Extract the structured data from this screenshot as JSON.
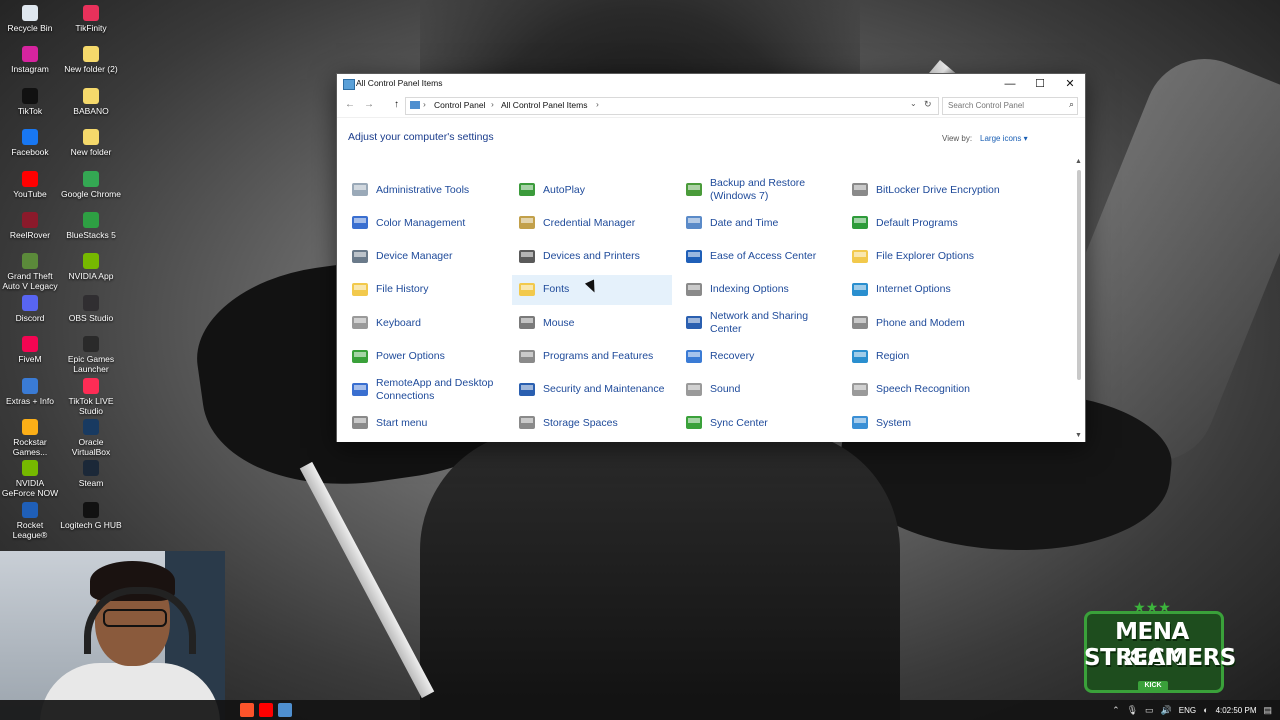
{
  "desktop_icons": [
    {
      "label": "Recycle Bin",
      "color": "#dfe7ef"
    },
    {
      "label": "TikFinity",
      "color": "#e8315b"
    },
    {
      "label": "Instagram",
      "color": "#d6249f"
    },
    {
      "label": "New folder (2)",
      "color": "#f5d96b"
    },
    {
      "label": "TikTok",
      "color": "#111111"
    },
    {
      "label": "BABANO",
      "color": "#f5d96b"
    },
    {
      "label": "Facebook",
      "color": "#1877f2"
    },
    {
      "label": "New folder",
      "color": "#f5d96b"
    },
    {
      "label": "YouTube",
      "color": "#ff0000"
    },
    {
      "label": "Google Chrome",
      "color": "#34a853"
    },
    {
      "label": "ReelRover",
      "color": "#8b1a2b"
    },
    {
      "label": "BlueStacks 5",
      "color": "#2ea043"
    },
    {
      "label": "Grand Theft Auto V Legacy",
      "color": "#5b8a3a"
    },
    {
      "label": "NVIDIA App",
      "color": "#76b900"
    },
    {
      "label": "Discord",
      "color": "#5865f2"
    },
    {
      "label": "OBS Studio",
      "color": "#302e31"
    },
    {
      "label": "FiveM",
      "color": "#f40552"
    },
    {
      "label": "Epic Games Launcher",
      "color": "#2a2a2a"
    },
    {
      "label": "Extras + Info",
      "color": "#3a7bd5"
    },
    {
      "label": "TikTok LIVE Studio",
      "color": "#fe2c55"
    },
    {
      "label": "Rockstar Games...",
      "color": "#fcaf17"
    },
    {
      "label": "Oracle VirtualBox",
      "color": "#183a61"
    },
    {
      "label": "NVIDIA GeForce NOW",
      "color": "#76b900"
    },
    {
      "label": "Steam",
      "color": "#1b2838"
    },
    {
      "label": "Rocket League®",
      "color": "#1f5fb8"
    },
    {
      "label": "Logitech G HUB",
      "color": "#111111"
    }
  ],
  "window": {
    "title": "All Control Panel Items",
    "controls": {
      "minimize": "—",
      "maximize": "☐",
      "close": "✕"
    },
    "nav": {
      "back": "←",
      "forward": "→",
      "up": "↑"
    },
    "breadcrumb": [
      "Control Panel",
      "All Control Panel Items"
    ],
    "search_placeholder": "Search Control Panel",
    "heading": "Adjust your computer's settings",
    "view_by_label": "View by:",
    "view_by_value": "Large icons ▾",
    "items": [
      {
        "label": "Administrative Tools",
        "icon": "admin-tools-icon",
        "color": "#9aa9b8"
      },
      {
        "label": "AutoPlay",
        "icon": "autoplay-icon",
        "color": "#3b9b3b"
      },
      {
        "label": "Backup and Restore (Windows 7)",
        "icon": "backup-icon",
        "color": "#4a9b3a"
      },
      {
        "label": "BitLocker Drive Encryption",
        "icon": "bitlocker-icon",
        "color": "#8a8a8a"
      },
      {
        "label": "Color Management",
        "icon": "color-management-icon",
        "color": "#3a6fd0"
      },
      {
        "label": "Credential Manager",
        "icon": "credential-manager-icon",
        "color": "#c2a04a"
      },
      {
        "label": "Date and Time",
        "icon": "date-time-icon",
        "color": "#5a8ac8"
      },
      {
        "label": "Default Programs",
        "icon": "default-programs-icon",
        "color": "#2e9b3a"
      },
      {
        "label": "Device Manager",
        "icon": "device-manager-icon",
        "color": "#6a7a8a"
      },
      {
        "label": "Devices and Printers",
        "icon": "printer-icon",
        "color": "#5a5a5a"
      },
      {
        "label": "Ease of Access Center",
        "icon": "ease-access-icon",
        "color": "#1f5fb8"
      },
      {
        "label": "File Explorer Options",
        "icon": "folder-options-icon",
        "color": "#f2c94c"
      },
      {
        "label": "File History",
        "icon": "file-history-icon",
        "color": "#f2c94c"
      },
      {
        "label": "Fonts",
        "icon": "fonts-icon",
        "color": "#f2c94c"
      },
      {
        "label": "Indexing Options",
        "icon": "indexing-icon",
        "color": "#8a8a8a"
      },
      {
        "label": "Internet Options",
        "icon": "internet-options-icon",
        "color": "#2a8fcf"
      },
      {
        "label": "Keyboard",
        "icon": "keyboard-icon",
        "color": "#9a9a9a"
      },
      {
        "label": "Mouse",
        "icon": "mouse-icon",
        "color": "#7a7a7a"
      },
      {
        "label": "Network and Sharing Center",
        "icon": "network-icon",
        "color": "#2a5fb0"
      },
      {
        "label": "Phone and Modem",
        "icon": "phone-modem-icon",
        "color": "#8a8a8a"
      },
      {
        "label": "Power Options",
        "icon": "power-options-icon",
        "color": "#3aa13a"
      },
      {
        "label": "Programs and Features",
        "icon": "programs-features-icon",
        "color": "#8a8a8a"
      },
      {
        "label": "Recovery",
        "icon": "recovery-icon",
        "color": "#3a7bd5"
      },
      {
        "label": "Region",
        "icon": "region-icon",
        "color": "#2a8fcf"
      },
      {
        "label": "RemoteApp and Desktop Connections",
        "icon": "remoteapp-icon",
        "color": "#3a6fd0"
      },
      {
        "label": "Security and Maintenance",
        "icon": "security-flag-icon",
        "color": "#2a5fb0"
      },
      {
        "label": "Sound",
        "icon": "sound-icon",
        "color": "#9a9a9a"
      },
      {
        "label": "Speech Recognition",
        "icon": "microphone-icon",
        "color": "#9a9a9a"
      },
      {
        "label": "Start menu",
        "icon": "start-menu-icon",
        "color": "#8a8a8a"
      },
      {
        "label": "Storage Spaces",
        "icon": "storage-spaces-icon",
        "color": "#8a8a8a"
      },
      {
        "label": "Sync Center",
        "icon": "sync-center-icon",
        "color": "#3aa13a"
      },
      {
        "label": "System",
        "icon": "system-icon",
        "color": "#3a8fd5"
      }
    ]
  },
  "logo": {
    "line1": "MENA KICK",
    "line2": "STREAMERS",
    "stars": "★★★",
    "tag": "KICK"
  },
  "taskbar": {
    "apps": [
      {
        "name": "brave-icon",
        "color": "#fb542b"
      },
      {
        "name": "youtube-icon",
        "color": "#ff0000"
      },
      {
        "name": "control-panel-icon",
        "color": "#4f8fcf"
      }
    ],
    "lang": "ENG",
    "time": "4:02:50 PM"
  }
}
